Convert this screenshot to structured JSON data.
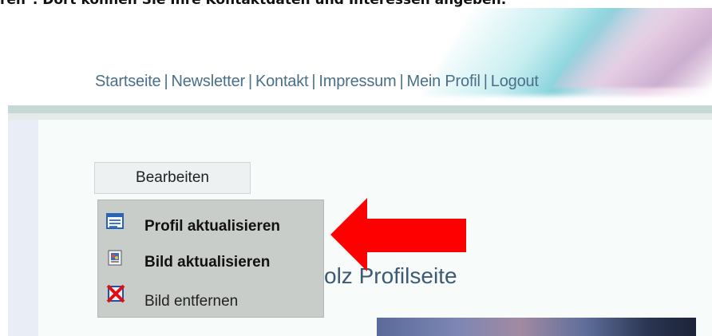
{
  "caption": {
    "text": "ren\". Dort können Sie Ihre Kontaktdaten und Interessen angeben."
  },
  "nav": {
    "items": [
      {
        "label": "Startseite"
      },
      {
        "label": "Newsletter"
      },
      {
        "label": "Kontakt"
      },
      {
        "label": "Impressum"
      },
      {
        "label": "Mein Profil"
      },
      {
        "label": "Logout"
      }
    ],
    "separator": "|"
  },
  "edit_button": {
    "label": "Bearbeiten"
  },
  "menu": {
    "items": [
      {
        "label": "Profil aktualisieren",
        "icon": "profile-form-icon"
      },
      {
        "label": "Bild aktualisieren",
        "icon": "image-icon"
      },
      {
        "label": "Bild entfernen",
        "icon": "delete-image-icon"
      }
    ]
  },
  "profile": {
    "title_visible": "olz Profilseite"
  },
  "colors": {
    "nav_text": "#4a6f8a",
    "title_text": "#3f5a73",
    "menu_bg": "#c9cdc9",
    "arrow": "#ff0000"
  }
}
